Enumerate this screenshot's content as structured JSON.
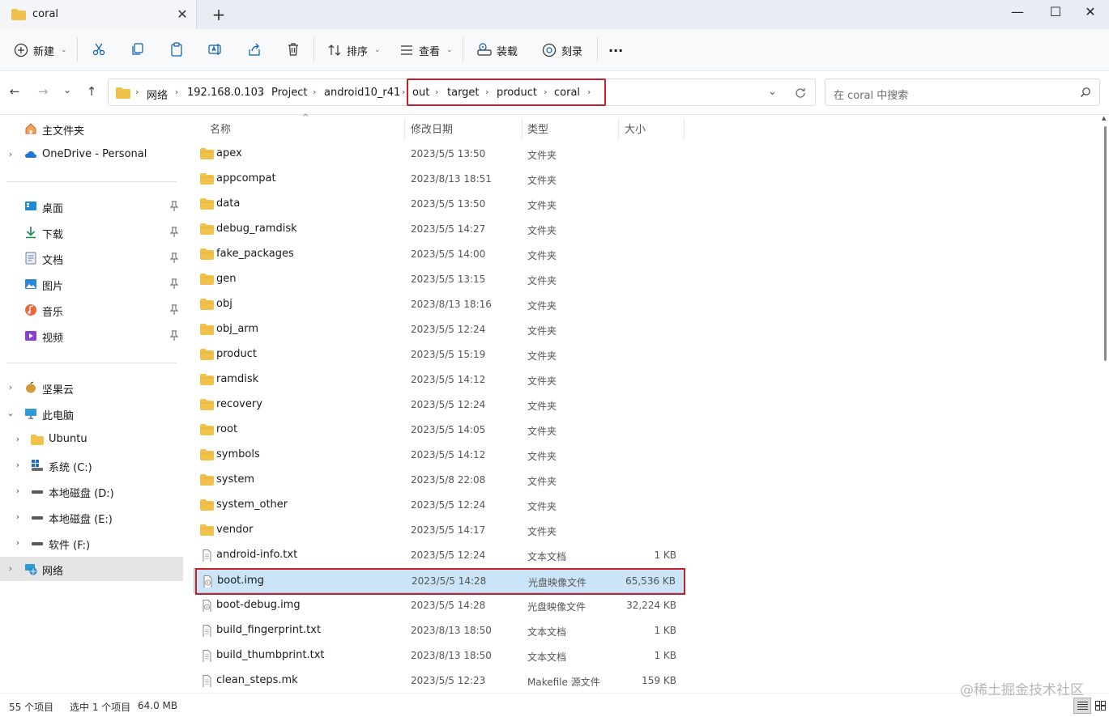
{
  "window": {
    "tab_title": "coral",
    "tab_close": "✕",
    "new_tab": "+",
    "minimize": "—",
    "maximize": "☐",
    "close": "✕"
  },
  "toolbar": {
    "new_label": "新建",
    "sort_label": "排序",
    "view_label": "查看",
    "mount_label": "装载",
    "burn_label": "刻录",
    "more_label": "···"
  },
  "address": {
    "breadcrumbs": [
      "网络",
      "192.168.0.103",
      "Project",
      "android10_r41",
      "out",
      "target",
      "product",
      "coral"
    ],
    "search_placeholder": "在 coral 中搜索"
  },
  "sidebar": {
    "home": "主文件夹",
    "onedrive": "OneDrive - Personal",
    "quick_access": [
      "桌面",
      "下载",
      "文档",
      "图片",
      "音乐",
      "视频"
    ],
    "jianguoyun": "坚果云",
    "this_pc": "此电脑",
    "drives": [
      "Ubuntu",
      "系统 (C:)",
      "本地磁盘 (D:)",
      "本地磁盘 (E:)",
      "软件 (F:)"
    ],
    "network": "网络"
  },
  "columns": {
    "name": "名称",
    "modified": "修改日期",
    "type": "类型",
    "size": "大小"
  },
  "files": [
    {
      "name": "apex",
      "date": "2023/5/5 13:50",
      "type": "文件夹",
      "size": "",
      "kind": "folder"
    },
    {
      "name": "appcompat",
      "date": "2023/8/13 18:51",
      "type": "文件夹",
      "size": "",
      "kind": "folder"
    },
    {
      "name": "data",
      "date": "2023/5/5 13:50",
      "type": "文件夹",
      "size": "",
      "kind": "folder"
    },
    {
      "name": "debug_ramdisk",
      "date": "2023/5/5 14:27",
      "type": "文件夹",
      "size": "",
      "kind": "folder"
    },
    {
      "name": "fake_packages",
      "date": "2023/5/5 14:00",
      "type": "文件夹",
      "size": "",
      "kind": "folder"
    },
    {
      "name": "gen",
      "date": "2023/5/5 13:15",
      "type": "文件夹",
      "size": "",
      "kind": "folder"
    },
    {
      "name": "obj",
      "date": "2023/8/13 18:16",
      "type": "文件夹",
      "size": "",
      "kind": "folder"
    },
    {
      "name": "obj_arm",
      "date": "2023/5/5 12:24",
      "type": "文件夹",
      "size": "",
      "kind": "folder"
    },
    {
      "name": "product",
      "date": "2023/5/5 15:19",
      "type": "文件夹",
      "size": "",
      "kind": "folder"
    },
    {
      "name": "ramdisk",
      "date": "2023/5/5 14:12",
      "type": "文件夹",
      "size": "",
      "kind": "folder"
    },
    {
      "name": "recovery",
      "date": "2023/5/5 12:24",
      "type": "文件夹",
      "size": "",
      "kind": "folder"
    },
    {
      "name": "root",
      "date": "2023/5/5 14:05",
      "type": "文件夹",
      "size": "",
      "kind": "folder"
    },
    {
      "name": "symbols",
      "date": "2023/5/5 14:12",
      "type": "文件夹",
      "size": "",
      "kind": "folder"
    },
    {
      "name": "system",
      "date": "2023/5/8 22:08",
      "type": "文件夹",
      "size": "",
      "kind": "folder"
    },
    {
      "name": "system_other",
      "date": "2023/5/5 12:24",
      "type": "文件夹",
      "size": "",
      "kind": "folder"
    },
    {
      "name": "vendor",
      "date": "2023/5/5 14:17",
      "type": "文件夹",
      "size": "",
      "kind": "folder"
    },
    {
      "name": "android-info.txt",
      "date": "2023/5/5 12:24",
      "type": "文本文档",
      "size": "1 KB",
      "kind": "file"
    },
    {
      "name": "boot.img",
      "date": "2023/5/5 14:28",
      "type": "光盘映像文件",
      "size": "65,536 KB",
      "kind": "img"
    },
    {
      "name": "boot-debug.img",
      "date": "2023/5/5 14:28",
      "type": "光盘映像文件",
      "size": "32,224 KB",
      "kind": "img"
    },
    {
      "name": "build_fingerprint.txt",
      "date": "2023/8/13 18:50",
      "type": "文本文档",
      "size": "1 KB",
      "kind": "file"
    },
    {
      "name": "build_thumbprint.txt",
      "date": "2023/8/13 18:50",
      "type": "文本文档",
      "size": "1 KB",
      "kind": "file"
    },
    {
      "name": "clean_steps.mk",
      "date": "2023/5/5 12:23",
      "type": "Makefile 源文件",
      "size": "159 KB",
      "kind": "file"
    }
  ],
  "status": {
    "count": "55 个项目",
    "selection": "选中 1 个项目",
    "selection_size": "64.0 MB",
    "watermark": "@稀土掘金技术社区"
  },
  "colors": {
    "folder": "#f0c14b",
    "selection": "#cce4f7",
    "highlight_box": "#c8202a",
    "accent": "#0067c0"
  }
}
